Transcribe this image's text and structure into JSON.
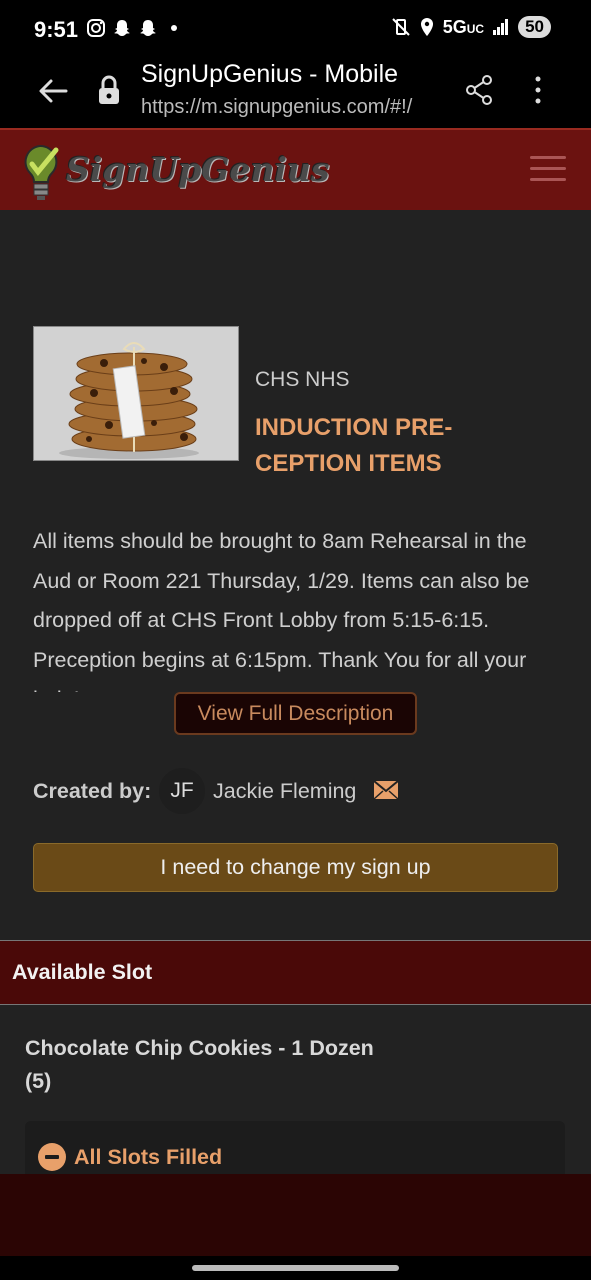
{
  "status_bar": {
    "time": "9:51",
    "network": "5G",
    "network_suffix": "UC",
    "battery": "50",
    "notification_icons": [
      "instagram-icon",
      "snapchat-icon",
      "snapchat-icon",
      "dot-icon"
    ]
  },
  "browser": {
    "page_title": "SignUpGenius - Mobile",
    "url": "https://m.signupgenius.com/#!/"
  },
  "header": {
    "logo_text": "SignUpGenius",
    "brand_color": "#6b1210"
  },
  "event": {
    "organization": "CHS NHS",
    "title": "INDUCTION PRE-CEPTION ITEMS",
    "description": "All items should be brought to 8am Rehearsal in the Aud or Room 221 Thursday, 1/29.  Items can also be dropped off at CHS Front Lobby from 5:15-6:15.  Preception begins at 6:15pm.  Thank You for all your help!",
    "view_full_label": "View Full Description",
    "created_by_label": "Created by:",
    "creator_initials": "JF",
    "creator_name": "Jackie Fleming",
    "change_button_label": "I need to change my sign up",
    "accent_color": "#e8a06a"
  },
  "slots": {
    "section_label": "Available Slot",
    "item_name": "Chocolate Chip Cookies - 1 Dozen",
    "item_count": "(5)",
    "status_label": "All Slots Filled"
  }
}
